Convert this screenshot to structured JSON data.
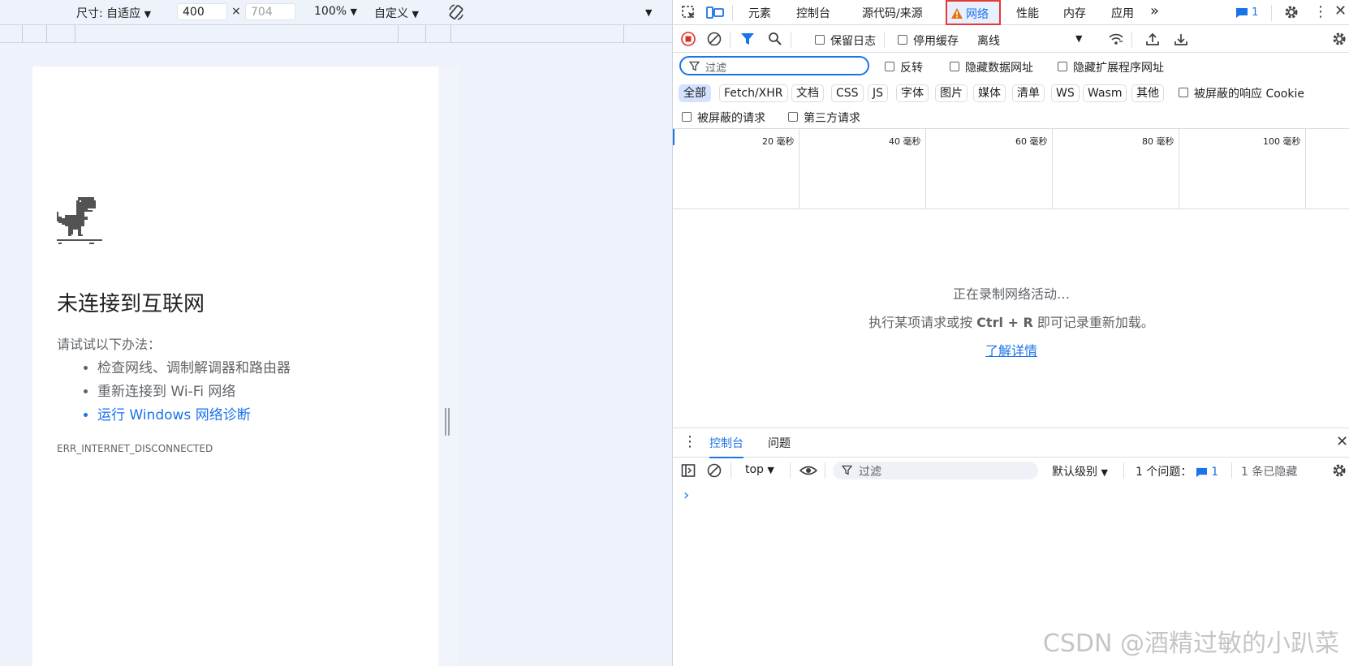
{
  "device_toolbar": {
    "dimensions_label": "尺寸: 自适应",
    "width_value": "400",
    "times": "×",
    "height_placeholder": "704",
    "zoom": "100%",
    "throttle": "自定义"
  },
  "page": {
    "title": "未连接到互联网",
    "try_text": "请试试以下办法：",
    "suggestions": [
      "检查网线、调制解调器和路由器",
      "重新连接到 Wi-Fi 网络",
      "运行 Windows 网络诊断"
    ],
    "error_code": "ERR_INTERNET_DISCONNECTED"
  },
  "devtools": {
    "tabs": [
      "元素",
      "控制台",
      "源代码/来源",
      "网络",
      "性能",
      "内存",
      "应用"
    ],
    "active_tab": "网络",
    "issues_count": "1",
    "network_toolbar": {
      "preserve_log": "保留日志",
      "disable_cache": "停用缓存",
      "throttling": "离线"
    },
    "filter": {
      "placeholder": "过滤",
      "invert": "反转",
      "hide_data_urls": "隐藏数据网址",
      "hide_extension_urls": "隐藏扩展程序网址"
    },
    "type_filters": [
      "全部",
      "Fetch/XHR",
      "文档",
      "CSS",
      "JS",
      "字体",
      "图片",
      "媒体",
      "清单",
      "WS",
      "Wasm",
      "其他"
    ],
    "blocked_cookies": "被屏蔽的响应 Cookie",
    "blocked_requests": "被屏蔽的请求",
    "third_party": "第三方请求",
    "timeline_labels": [
      "20 毫秒",
      "40 毫秒",
      "60 毫秒",
      "80 毫秒",
      "100 毫秒"
    ],
    "empty_state": {
      "line1": "正在录制网络活动…",
      "line2_pre": "执行某项请求或按 ",
      "line2_key": "Ctrl + R",
      "line2_post": " 即可记录重新加载。",
      "link": "了解详情"
    },
    "drawer": {
      "tabs": [
        "控制台",
        "问题"
      ],
      "context": "top",
      "filter_placeholder": "过滤",
      "level": "默认级别",
      "issues_label": "1 个问题：",
      "issues_count": "1",
      "hidden": "1 条已隐藏",
      "prompt": "›"
    }
  },
  "watermark": "CSDN @酒精过敏的小趴菜",
  "colors": {
    "accent": "#1a73e8",
    "highlight_border": "#e53935",
    "warning": "#e8710a",
    "record": "#d93025"
  }
}
